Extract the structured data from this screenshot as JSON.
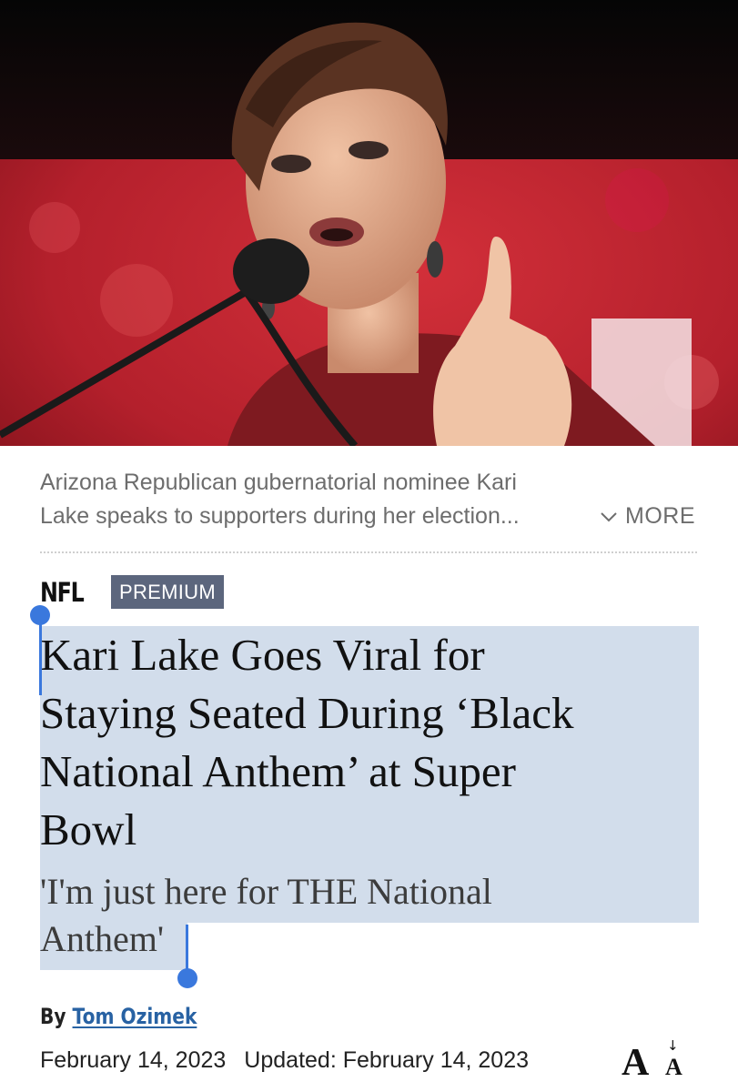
{
  "hero": {
    "icon": "article-photo"
  },
  "caption": {
    "line1": "Arizona Republican gubernatorial nominee Kari",
    "line2": "Lake speaks to supporters during her election...",
    "more_label": "MORE"
  },
  "tags": {
    "category": "NFL",
    "badge": "PREMIUM"
  },
  "article": {
    "headline_lines": [
      "Kari Lake Goes Viral for",
      "Staying Seated During ‘Black",
      "National Anthem’ at Super",
      "Bowl"
    ],
    "subhead_lines": [
      "'I'm just here for THE National",
      "Anthem'"
    ],
    "byline_prefix": "By",
    "author": "Tom Ozimek",
    "published": "February 14, 2023",
    "updated": "Updated: February 14, 2023"
  },
  "controls": {
    "font_size_big": "A",
    "font_size_small": "A",
    "font_size_arrow": "↓"
  },
  "colors": {
    "selection": "#d2ddeb",
    "selection_handle": "#3a78dd",
    "badge_bg": "#5c667d",
    "link": "#2862a3"
  }
}
